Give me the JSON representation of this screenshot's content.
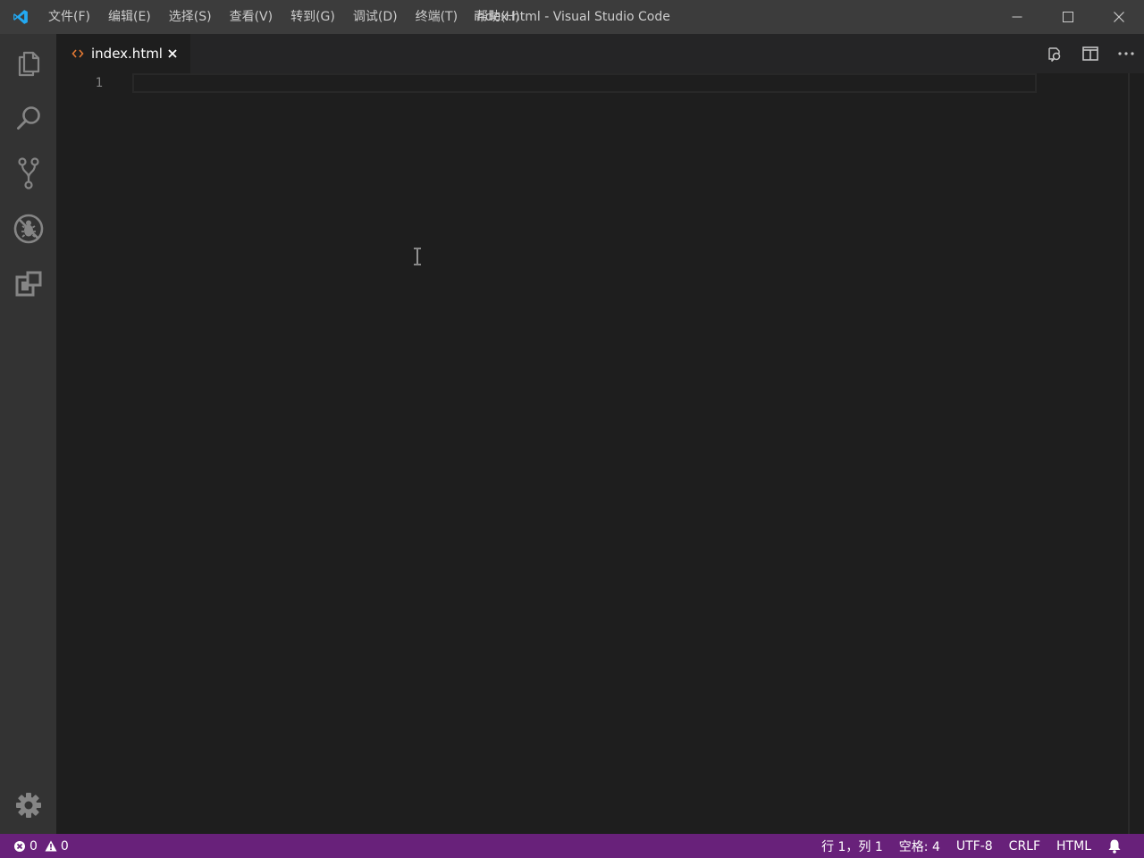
{
  "titlebar": {
    "menus": [
      "文件(F)",
      "编辑(E)",
      "选择(S)",
      "查看(V)",
      "转到(G)",
      "调试(D)",
      "终端(T)",
      "帮助(H)"
    ],
    "window_title": "index.html - Visual Studio Code"
  },
  "activitybar": {
    "items": [
      "explorer-icon",
      "search-icon",
      "source-control-icon",
      "debug-icon",
      "extensions-icon"
    ],
    "bottom": "gear-icon"
  },
  "tabs": [
    {
      "label": "index.html",
      "icon": "html-file-icon",
      "active": true
    }
  ],
  "editor": {
    "line_numbers": [
      "1"
    ]
  },
  "statusbar": {
    "errors": "0",
    "warnings": "0",
    "cursor_position": "行 1，列 1",
    "indentation": "空格: 4",
    "encoding": "UTF-8",
    "line_ending": "CRLF",
    "language": "HTML"
  },
  "colors": {
    "titlebar": "#3c3c3c",
    "activitybar": "#333333",
    "editor_bg": "#1e1e1e",
    "tabbar": "#252526",
    "statusbar": "#68217a",
    "vscode_blue": "#23a9f2",
    "html_icon": "#e37933"
  }
}
